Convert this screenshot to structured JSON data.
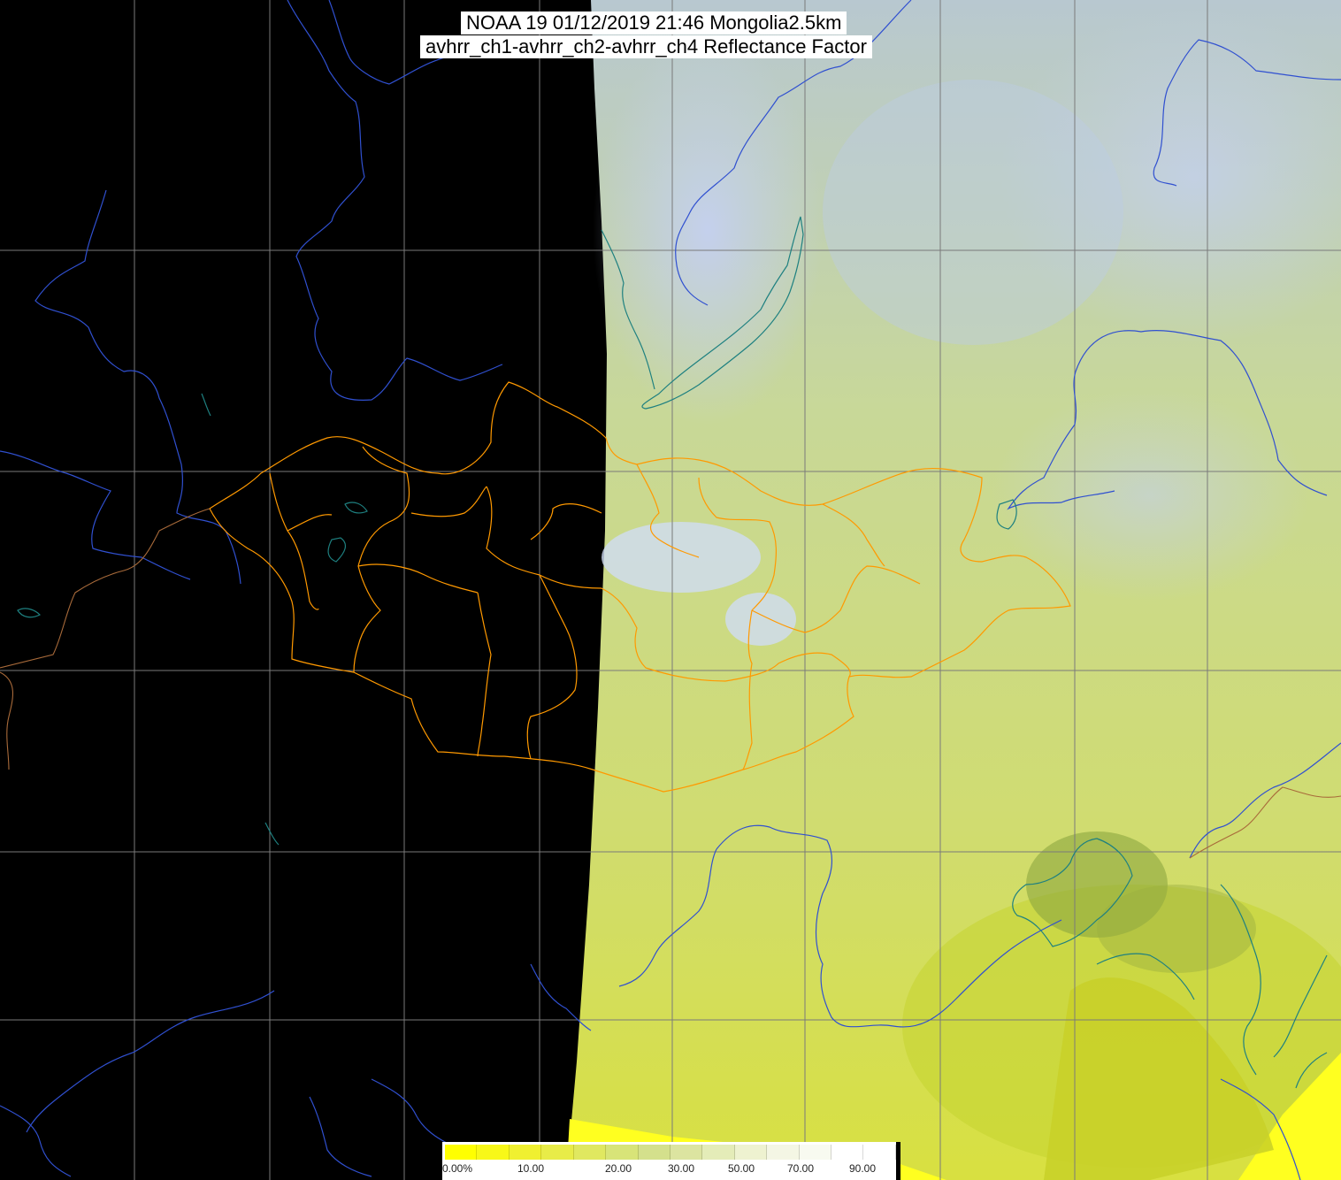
{
  "title": {
    "line1": "NOAA 19 01/12/2019 21:46 Mongolia2.5km",
    "line2": "avhrr_ch1-avhrr_ch2-avhrr_ch4 Reflectance Factor"
  },
  "legend": {
    "labels": [
      "0.00%",
      "10.00",
      "20.00",
      "30.00",
      "50.00",
      "70.00",
      "90.00"
    ],
    "colors": [
      "#ffff00",
      "#f8f818",
      "#f0f030",
      "#e8ec48",
      "#e0e860",
      "#d8e478",
      "#d4e08c",
      "#dce4a0",
      "#e4ecb8",
      "#eef2d0",
      "#f4f6e4",
      "#f8faf0",
      "#ffffff",
      "#ffffff"
    ]
  },
  "colors": {
    "background": "#000000",
    "imagery_green": "#c8d880",
    "imagery_yellow": "#d8e048",
    "imagery_blue": "#b8c8e8",
    "grid": "#808080",
    "rivers": "#3050d0",
    "borders": "#ff9900",
    "coast": "#2a8a8a"
  }
}
